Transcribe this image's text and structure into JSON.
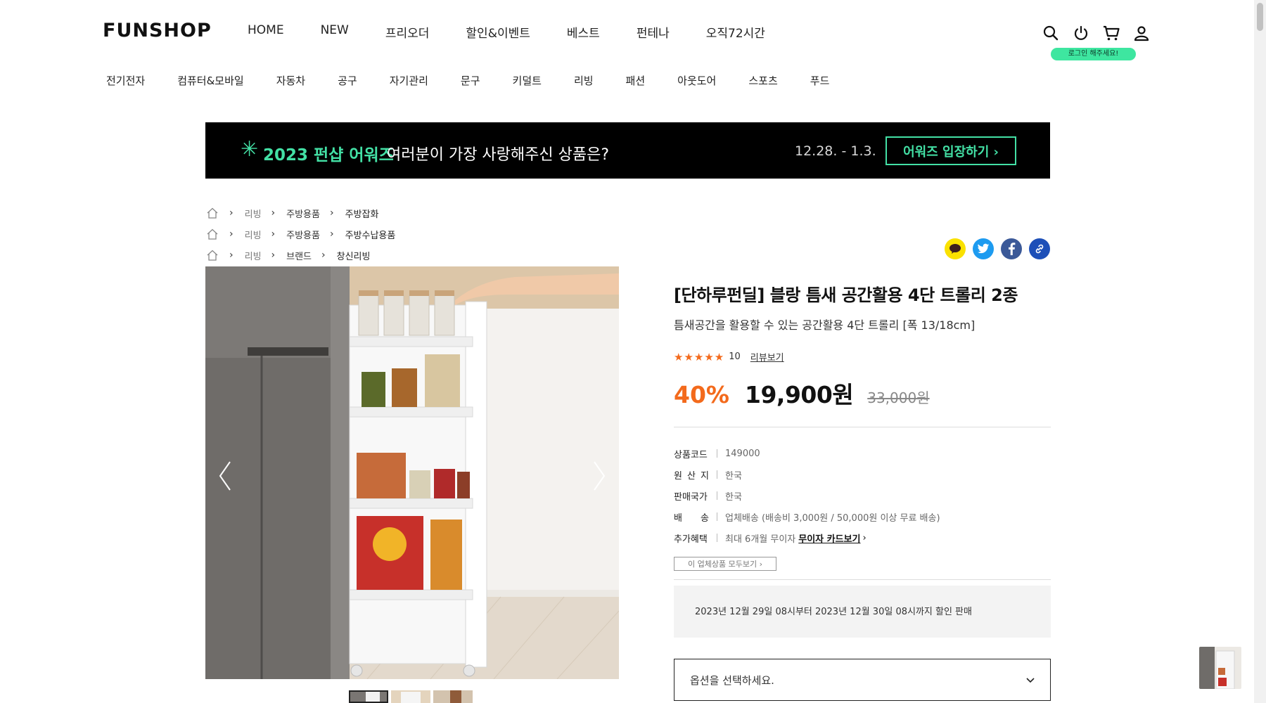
{
  "header": {
    "logo": "FUNSHOP",
    "nav": [
      "HOME",
      "NEW",
      "프리오더",
      "할인&이벤트",
      "베스트",
      "펀테나",
      "오직72시간"
    ],
    "icons": [
      "search-icon",
      "power-icon",
      "cart-icon",
      "user-icon"
    ],
    "login_badge": "로그인 해주세요!"
  },
  "categories": [
    "전기전자",
    "컴퓨터&모바일",
    "자동차",
    "공구",
    "자기관리",
    "문구",
    "키덜트",
    "리빙",
    "패션",
    "아웃도어",
    "스포츠",
    "푸드"
  ],
  "banner": {
    "title": "2023 펀샵 어워즈",
    "subtitle": "여러분이 가장 사랑해주신 상품은?",
    "date": "12.28. - 1.3.",
    "button": "어워즈 입장하기 ›"
  },
  "breadcrumbs": [
    [
      "리빙",
      "주방용품",
      "주방잡화"
    ],
    [
      "리빙",
      "주방용품",
      "주방수납용품"
    ],
    [
      "리빙",
      "브랜드",
      "창신리빙"
    ]
  ],
  "share": [
    "kakaotalk-icon",
    "twitter-icon",
    "facebook-icon",
    "link-icon"
  ],
  "product": {
    "title": "[단하루펀딜] 블랑 틈새 공간활용 4단 트롤리 2종",
    "subtitle": "틈새공간을 활용할 수 있는 공간활용 4단 트롤리 [폭 13/18cm]",
    "stars": "★★★★★",
    "rating": 5,
    "review_count": "10",
    "review_link": "리뷰보기",
    "discount": "40%",
    "price": "19,900원",
    "original_price": "33,000원",
    "specs": [
      {
        "label": "상품코드",
        "value": "149000"
      },
      {
        "label": "원 산 지",
        "value": "한국"
      },
      {
        "label": "판매국가",
        "value": "한국"
      },
      {
        "label": "배 송",
        "value": "업체배송 (배송비 3,000원 / 50,000원 이상 무료 배송)"
      },
      {
        "label": "추가혜택",
        "value": "최대 6개월 무이자",
        "link": "무이자 카드보기"
      }
    ],
    "vendor_button": "이 업체상품 모두보기 ›",
    "notice": "2023년 12월 29일 08시부터 2023년 12월 30일 08시까지 할인 판매",
    "option_placeholder": "옵션을 선택하세요."
  },
  "colors": {
    "accent": "#f36a1c",
    "brand_green": "#43e0a5",
    "banner_bg": "#000000"
  }
}
